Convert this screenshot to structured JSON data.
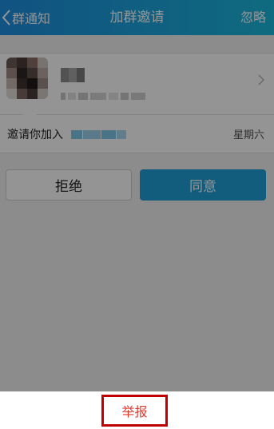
{
  "header": {
    "back_label": "群通知",
    "title": "加群邀请",
    "ignore_label": "忽略"
  },
  "invite": {
    "label": "邀请你加入",
    "day": "星期六"
  },
  "actions": {
    "reject_label": "拒绝",
    "accept_label": "同意"
  },
  "sheet": {
    "report_label": "举报"
  },
  "colors": {
    "header_gradient_start": "#1e8fe0",
    "header_gradient_end": "#1ab8dc",
    "accept_button": "#1fa0da",
    "report_text": "#e03a2f",
    "report_highlight": "#c00000"
  }
}
